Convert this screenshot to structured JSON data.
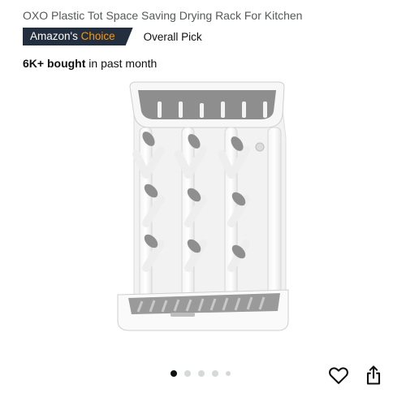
{
  "product": {
    "title": "OXO Plastic Tot Space Saving Drying Rack For Kitchen",
    "badge_prefix": "Amazon's",
    "badge_accent": "Choice",
    "badge_extra": "Overall Pick",
    "bought_strong": "6K+ bought",
    "bought_rest": " in past month"
  },
  "carousel": {
    "image_count": 5,
    "active_index": 0
  },
  "icons": {
    "favorite": "heart-icon",
    "share": "share-icon"
  },
  "colors": {
    "badge_bg": "#232f3e",
    "badge_accent": "#ff9900",
    "active_dot": "#0f1111",
    "inactive_dot": "#d5d9d9"
  }
}
